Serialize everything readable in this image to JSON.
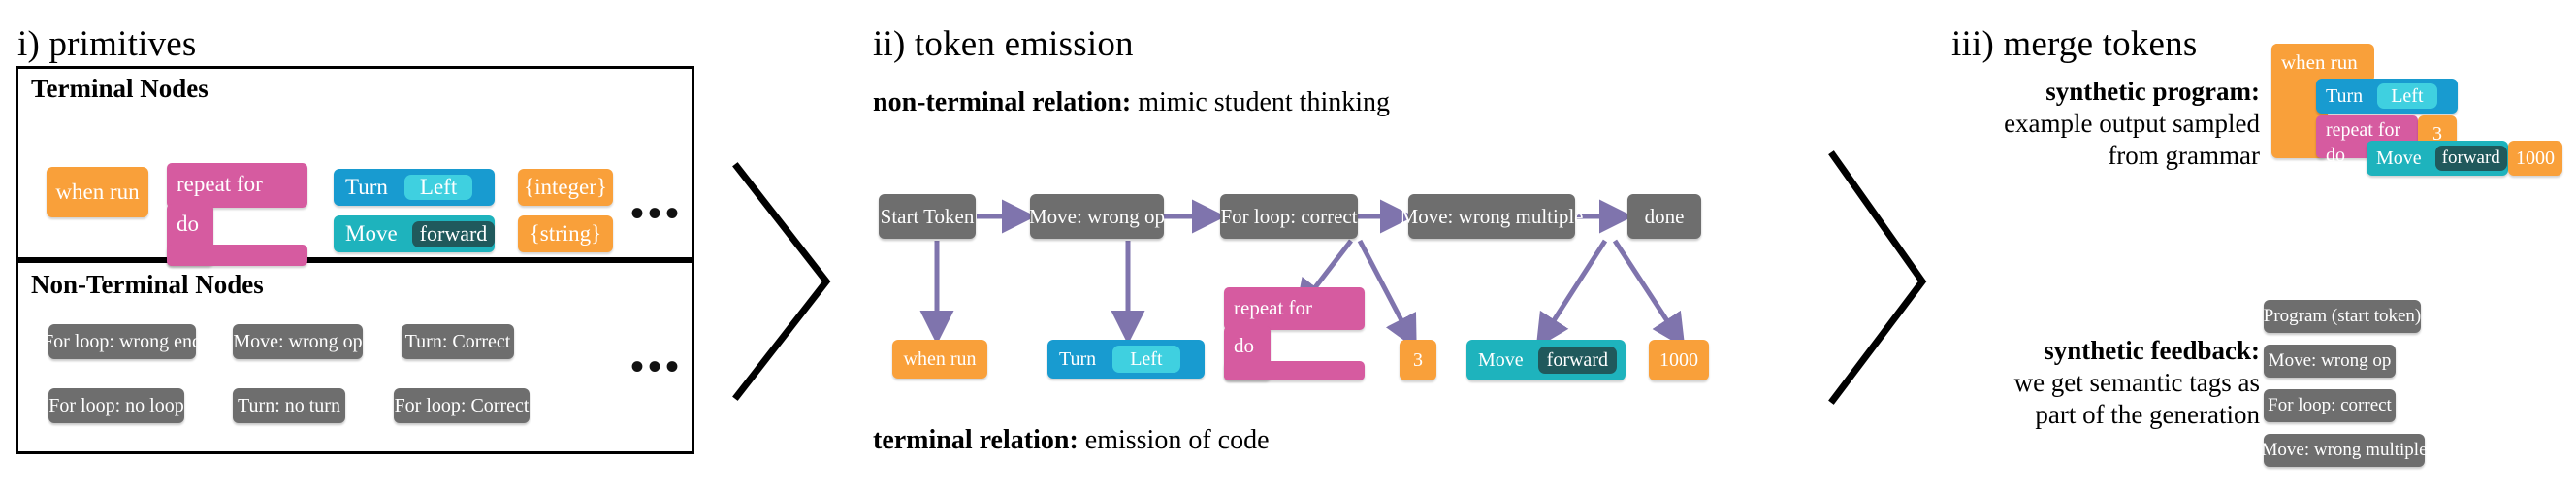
{
  "panels": {
    "i": {
      "title": "i) primitives",
      "terminal_label": "Terminal Nodes",
      "nonterminal_label": "Non-Terminal Nodes",
      "terminal_blocks": {
        "when_run": "when run",
        "repeat_for": "repeat for",
        "repeat_do": "do",
        "turn": "Turn",
        "turn_arg": "Left",
        "move": "Move",
        "move_arg": "forward",
        "integer": "{integer}",
        "string": "{string}"
      },
      "nonterminal_tags": [
        "For loop: wrong end",
        "Move: wrong op",
        "Turn: Correct",
        "For loop: no loop",
        "Turn: no turn",
        "For loop: Correct"
      ],
      "ellipsis": "•••"
    },
    "ii": {
      "title": "ii) token emission",
      "nonterminal_relation_bold": "non-terminal relation:",
      "nonterminal_relation_rest": " mimic student thinking",
      "terminal_relation_bold": "terminal relation:",
      "terminal_relation_rest": "  emission of code",
      "chain": [
        "Start Token",
        "Move: wrong op",
        "For loop: correct",
        "Move: wrong multiple",
        "done"
      ],
      "emitted": {
        "when_run": "when run",
        "turn": "Turn",
        "turn_arg": "Left",
        "repeat_for": "repeat for",
        "repeat_do": "do",
        "three": "3",
        "move": "Move",
        "move_arg": "forward",
        "thousand": "1000"
      }
    },
    "iii": {
      "title": "iii) merge tokens",
      "program_caption_bold": "synthetic program:",
      "program_caption_line1": "example output sampled",
      "program_caption_line2": "from grammar",
      "feedback_caption_bold": "synthetic feedback:",
      "feedback_caption_line1": "we get semantic tags as",
      "feedback_caption_line2": "part of the generation",
      "program": {
        "when_run": "when run",
        "turn": "Turn",
        "turn_arg": "Left",
        "repeat_for": "repeat for",
        "repeat_count": "3",
        "repeat_do": "do",
        "move": "Move",
        "move_arg": "forward",
        "move_count": "1000"
      },
      "feedback_tags": [
        "Program (start token)",
        "Move: wrong op",
        "For loop: correct",
        "Move: wrong multiple"
      ]
    }
  },
  "colors": {
    "orange": "#f9a03a",
    "pink": "#d65ba0",
    "blue": "#189bd0",
    "blue_light": "#3fd0e0",
    "teal": "#1eb3bd",
    "teal_dark": "#20595c",
    "gray": "#6e6e6e",
    "arrow_purple": "#7f74ad",
    "outline": "#000000"
  }
}
